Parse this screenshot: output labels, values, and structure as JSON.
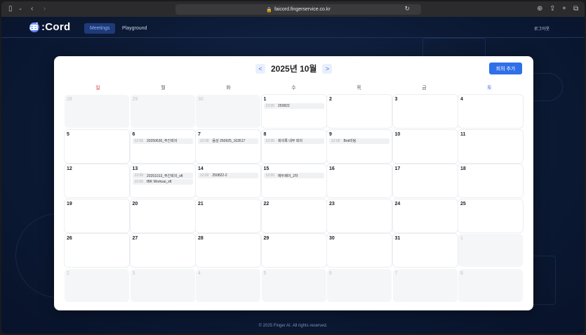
{
  "browser": {
    "url": "faicord.fingerservice.co.kr"
  },
  "header": {
    "logo": ":Cord",
    "logo_sub": "ai",
    "nav": [
      {
        "label": "Meetings"
      },
      {
        "label": "Playground"
      }
    ],
    "logout": "로그아웃"
  },
  "calendar": {
    "title": "2025년 10월",
    "prev": "<",
    "next": ">",
    "add_button": "회의 추가",
    "weekdays": [
      "일",
      "월",
      "화",
      "수",
      "목",
      "금",
      "토"
    ],
    "weeks": [
      [
        {
          "day": "28",
          "other": true,
          "events": []
        },
        {
          "day": "29",
          "other": true,
          "events": []
        },
        {
          "day": "30",
          "other": true,
          "events": []
        },
        {
          "day": "1",
          "other": false,
          "events": [
            {
              "time": "12:00",
              "title": "250822"
            }
          ]
        },
        {
          "day": "2",
          "other": false,
          "events": []
        },
        {
          "day": "3",
          "other": false,
          "events": []
        },
        {
          "day": "4",
          "other": false,
          "events": []
        }
      ],
      [
        {
          "day": "5",
          "other": false,
          "events": []
        },
        {
          "day": "6",
          "other": false,
          "events": [
            {
              "time": "12:00",
              "title": "20250630_주간회의"
            }
          ]
        },
        {
          "day": "7",
          "other": false,
          "events": [
            {
              "time": "12:00",
              "title": "음성 250925_163517"
            }
          ]
        },
        {
          "day": "8",
          "other": false,
          "events": [
            {
              "time": "12:00",
              "title": "회의록 내부 회의"
            }
          ]
        },
        {
          "day": "9",
          "other": false,
          "events": [
            {
              "time": "12:00",
              "title": "Bnk미팅"
            }
          ]
        },
        {
          "day": "10",
          "other": false,
          "events": []
        },
        {
          "day": "11",
          "other": false,
          "events": []
        }
      ],
      [
        {
          "day": "12",
          "other": false,
          "events": []
        },
        {
          "day": "13",
          "other": false,
          "events": [
            {
              "time": "12:00",
              "title": "20251013_주간회의_sft"
            },
            {
              "time": "12:00",
              "title": "IBK Worksai_sft"
            }
          ]
        },
        {
          "day": "14",
          "other": false,
          "events": [
            {
              "time": "12:00",
              "title": "250822-2"
            }
          ]
        },
        {
          "day": "15",
          "other": false,
          "events": [
            {
              "time": "12:00",
              "title": "예두페이_2차"
            }
          ]
        },
        {
          "day": "16",
          "other": false,
          "events": []
        },
        {
          "day": "17",
          "other": false,
          "events": []
        },
        {
          "day": "18",
          "other": false,
          "events": []
        }
      ],
      [
        {
          "day": "19",
          "other": false,
          "events": []
        },
        {
          "day": "20",
          "other": false,
          "events": []
        },
        {
          "day": "21",
          "other": false,
          "events": []
        },
        {
          "day": "22",
          "other": false,
          "events": []
        },
        {
          "day": "23",
          "other": false,
          "events": []
        },
        {
          "day": "24",
          "other": false,
          "events": []
        },
        {
          "day": "25",
          "other": false,
          "events": []
        }
      ],
      [
        {
          "day": "26",
          "other": false,
          "events": []
        },
        {
          "day": "27",
          "other": false,
          "events": []
        },
        {
          "day": "28",
          "other": false,
          "events": []
        },
        {
          "day": "29",
          "other": false,
          "events": []
        },
        {
          "day": "30",
          "other": false,
          "events": []
        },
        {
          "day": "31",
          "other": false,
          "events": []
        },
        {
          "day": "1",
          "other": true,
          "events": []
        }
      ],
      [
        {
          "day": "2",
          "other": true,
          "events": []
        },
        {
          "day": "3",
          "other": true,
          "events": []
        },
        {
          "day": "4",
          "other": true,
          "events": []
        },
        {
          "day": "5",
          "other": true,
          "events": []
        },
        {
          "day": "6",
          "other": true,
          "events": []
        },
        {
          "day": "7",
          "other": true,
          "events": []
        },
        {
          "day": "8",
          "other": true,
          "events": []
        }
      ]
    ]
  },
  "footer": "© 2025 Finger AI. All rights reserved.",
  "colors": {
    "accent": "#2f6fe8",
    "sunday": "#e04040",
    "saturday": "#3a6ee8",
    "page_bg": "#0d1a33"
  }
}
